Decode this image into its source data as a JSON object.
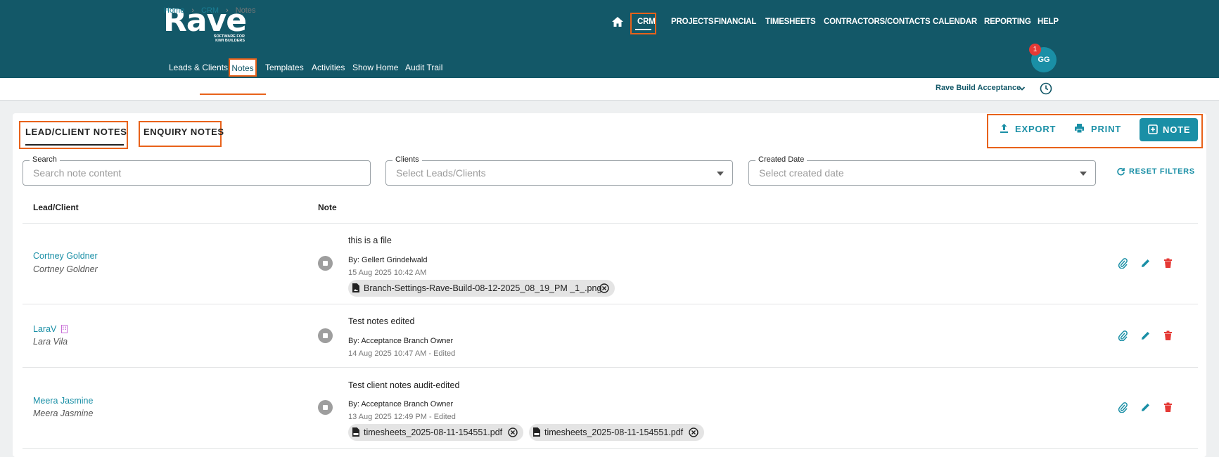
{
  "brand": {
    "name": "Rave",
    "tagline_line1": "SOFTWARE FOR",
    "tagline_line2": "KIWI BUILDERS"
  },
  "main_nav": {
    "items": [
      "CRM",
      "PROJECTS",
      "FINANCIAL",
      "TIMESHEETS",
      "CONTRACTORS/CONTACTS",
      "CALENDAR",
      "REPORTING",
      "HELP"
    ],
    "active": "CRM"
  },
  "sub_nav": {
    "items": [
      "Leads & Clients",
      "Notes",
      "Templates",
      "Activities",
      "Show Home",
      "Audit Trail"
    ],
    "active": "Notes"
  },
  "user": {
    "initials": "GG",
    "notification_count": "1"
  },
  "breadcrumb": {
    "home": "Home",
    "section": "CRM",
    "current": "Notes",
    "separator": "›"
  },
  "company_selector": {
    "value": "Rave Build Acceptance"
  },
  "tabs": {
    "lead_client": "LEAD/CLIENT NOTES",
    "enquiry": "ENQUIRY NOTES"
  },
  "actions": {
    "export": "EXPORT",
    "print": "PRINT",
    "note": "NOTE"
  },
  "filters": {
    "search": {
      "label": "Search",
      "placeholder": "Search note content"
    },
    "clients": {
      "label": "Clients",
      "placeholder": "Select Leads/Clients"
    },
    "created_date": {
      "label": "Created Date",
      "placeholder": "Select created date"
    },
    "reset": "RESET FILTERS"
  },
  "table": {
    "columns": [
      "Lead/Client",
      "Note"
    ],
    "rows": [
      {
        "client_link": "Cortney Goldner",
        "client_name": "Cortney Goldner",
        "note": "this is a file",
        "by": "By: Gellert Grindelwald",
        "date": "15 Aug 2025 10:42 AM",
        "attachments": [
          "Branch-Settings-Rave-Build-08-12-2025_08_19_PM _1_.png"
        ]
      },
      {
        "client_link": "LaraV",
        "client_name": "Lara Vila",
        "note": "Test notes edited",
        "by": "By: Acceptance Branch Owner",
        "date": "14 Aug 2025 10:47 AM - Edited",
        "attachments": []
      },
      {
        "client_link": "Meera Jasmine",
        "client_name": "Meera Jasmine",
        "note": "Test client notes audit-edited",
        "by": "By: Acceptance Branch Owner",
        "date": "13 Aug 2025 12:49 PM - Edited",
        "attachments": [
          "timesheets_2025-08-11-154551.pdf",
          "timesheets_2025-08-11-154551.pdf"
        ]
      }
    ]
  },
  "colors": {
    "header_bg": "#135868",
    "accent": "#1a8fa6",
    "highlight_outline": "#e8621a",
    "delete": "#e53935",
    "building_icon": "#c86dd7"
  },
  "icons": {
    "row_actions": [
      "paperclip-icon",
      "pencil-icon",
      "trash-icon"
    ]
  }
}
